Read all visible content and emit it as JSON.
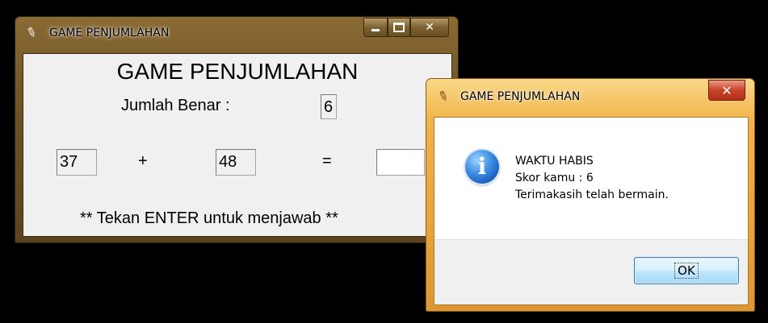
{
  "main_window": {
    "title": "GAME PENJUMLAHAN",
    "icon": "feather-icon",
    "controls": {
      "minimize": "minimize-icon",
      "maximize": "maximize-icon",
      "close": "✕"
    },
    "heading": "GAME PENJUMLAHAN",
    "score_label": "Jumlah Benar :",
    "score_value": "6",
    "operand_a": "37",
    "operator": "+",
    "operand_b": "48",
    "equals": "=",
    "answer_value": "",
    "instruction": "** Tekan ENTER untuk menjawab **"
  },
  "dialog": {
    "title": "GAME PENJUMLAHAN",
    "icon": "feather-icon",
    "close": "✕",
    "info_icon": "i",
    "message_lines": [
      "WAKTU HABIS",
      "Skor kamu : 6",
      "Terimakasih telah bermain."
    ],
    "ok_label": "OK"
  },
  "colors": {
    "main_frame": "#6e5226",
    "dialog_frame": "#e9a43a",
    "client_bg": "#f0f0f0",
    "ok_button": "#bee6fd",
    "info_blue": "#1a56b8"
  }
}
